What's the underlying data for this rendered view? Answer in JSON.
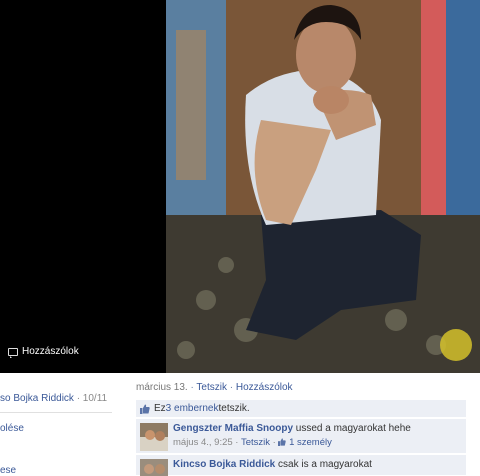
{
  "photo_viewer": {
    "comment_action": "Hozzászólok"
  },
  "left_panel": {
    "tagger_name": "so Bojka Riddick",
    "tagger_date": " · 10/11",
    "link_1": "olése",
    "link_2": "ese"
  },
  "meta": {
    "date": "március 13.",
    "sep": " · ",
    "like_label": "Tetszik",
    "comment_label": "Hozzászólok"
  },
  "likes": {
    "prefix": "Ez ",
    "count_link": "3 embernek",
    "suffix": " tetszik."
  },
  "comments": [
    {
      "author": "Gengszter Maffia Snoopy",
      "text": " ussed a magyarokat hehe",
      "time": "május 4., 9:25",
      "like_label": "Tetszik",
      "likes_count": "1 személy"
    },
    {
      "author": "Kincso Bojka Riddick",
      "text": " csak is a magyarokat"
    }
  ],
  "colors": {
    "link": "#3b5998",
    "comment_bg": "#eceff5",
    "viewer_bg": "#000000"
  }
}
